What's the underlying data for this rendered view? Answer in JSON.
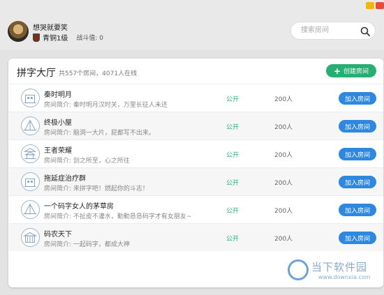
{
  "user": {
    "name": "想哭就要笑",
    "rank_label": "青铜1级",
    "power_label": "战斗值: 0"
  },
  "search": {
    "placeholder": "搜索房间"
  },
  "lobby": {
    "title": "拼字大厅",
    "subtitle": "共557个房间，4071人在线",
    "create_label": "创建房间"
  },
  "rooms": [
    {
      "name": "秦时明月",
      "desc": "房间简介: 秦时明月汉时关，万里长征人未还",
      "status": "公开",
      "count": "200人",
      "join_label": "加入房间",
      "icon": "building-icon"
    },
    {
      "name": "终极小屋",
      "desc": "房间简介: 脑洞一大片，屁都写不出来。",
      "status": "公开",
      "count": "200人",
      "join_label": "加入房间",
      "icon": "tent-icon"
    },
    {
      "name": "王者荣耀",
      "desc": "房间简介: 剑之所至，心之所往",
      "status": "公开",
      "count": "200人",
      "join_label": "加入房间",
      "icon": "pagoda-icon"
    },
    {
      "name": "拖延症治疗群",
      "desc": "房间简介: 来拼字吧！燃起你的斗志！",
      "status": "公开",
      "count": "200人",
      "join_label": "加入房间",
      "icon": "building-icon"
    },
    {
      "name": "一个码字女人的茅草房",
      "desc": "房间简介: 不扯皮不灌水，勤勤恳恳码字才有女朋友~",
      "status": "公开",
      "count": "200人",
      "join_label": "加入房间",
      "icon": "tent-icon"
    },
    {
      "name": "码农天下",
      "desc": "房间简介: 一起码字，都成大神",
      "status": "公开",
      "count": "200人",
      "join_label": "加入房间",
      "icon": "palace-icon"
    }
  ],
  "watermark": {
    "title": "当下软件园",
    "url": "www.downxia.com"
  }
}
